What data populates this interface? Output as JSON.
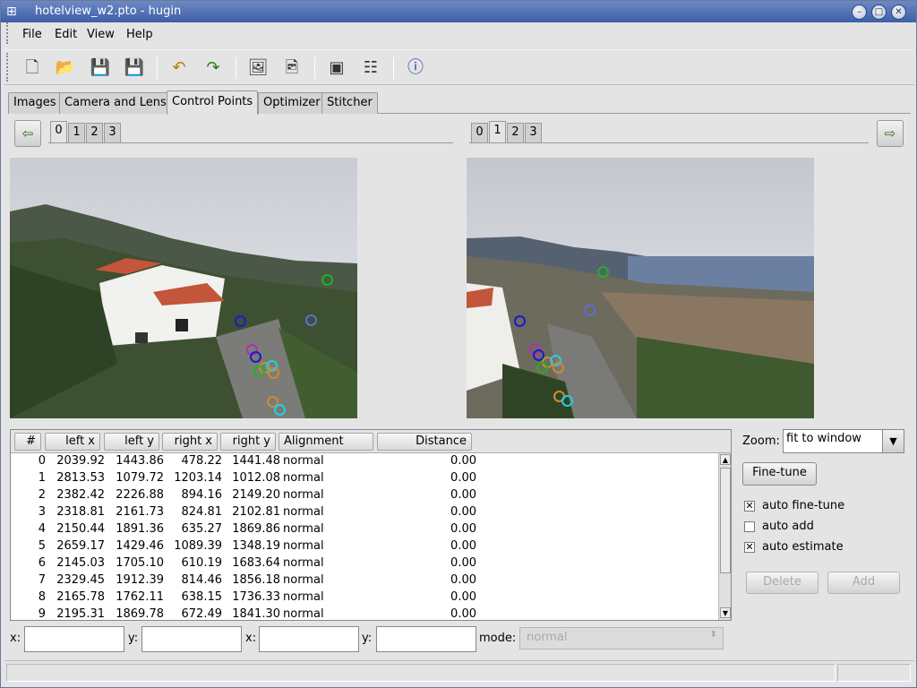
{
  "window": {
    "title": "hotelview_w2.pto - hugin"
  },
  "menu": {
    "items": [
      "File",
      "Edit",
      "View",
      "Help"
    ]
  },
  "toolbar": {
    "icons": [
      "new-file-icon",
      "open-folder-icon",
      "save-icon",
      "save-as-icon",
      "undo-icon",
      "redo-icon",
      "add-image-icon",
      "add-time-series-icon",
      "preview-icon",
      "assistant-icon",
      "info-icon"
    ]
  },
  "tabs": [
    "Images",
    "Camera and Lens",
    "Control Points",
    "Optimizer",
    "Stitcher"
  ],
  "left_images": {
    "tabs": [
      "0",
      "1",
      "2",
      "3"
    ],
    "selected": "0"
  },
  "right_images": {
    "tabs": [
      "0",
      "1",
      "2",
      "3"
    ],
    "selected": "1"
  },
  "table": {
    "headers": [
      "#",
      "left x",
      "left y",
      "right x",
      "right y",
      "Alignment",
      "Distance"
    ],
    "rows": [
      [
        "0",
        "2039.92",
        "1443.86",
        "478.22",
        "1441.48",
        "normal",
        "0.00"
      ],
      [
        "1",
        "2813.53",
        "1079.72",
        "1203.14",
        "1012.08",
        "normal",
        "0.00"
      ],
      [
        "2",
        "2382.42",
        "2226.88",
        "894.16",
        "2149.20",
        "normal",
        "0.00"
      ],
      [
        "3",
        "2318.81",
        "2161.73",
        "824.81",
        "2102.81",
        "normal",
        "0.00"
      ],
      [
        "4",
        "2150.44",
        "1891.36",
        "635.27",
        "1869.86",
        "normal",
        "0.00"
      ],
      [
        "5",
        "2659.17",
        "1429.46",
        "1089.39",
        "1348.19",
        "normal",
        "0.00"
      ],
      [
        "6",
        "2145.03",
        "1705.10",
        "610.19",
        "1683.64",
        "normal",
        "0.00"
      ],
      [
        "7",
        "2329.45",
        "1912.39",
        "814.46",
        "1856.18",
        "normal",
        "0.00"
      ],
      [
        "8",
        "2165.78",
        "1762.11",
        "638.15",
        "1736.33",
        "normal",
        "0.00"
      ],
      [
        "9",
        "2195.31",
        "1869.78",
        "672.49",
        "1841.30",
        "normal",
        "0.00"
      ]
    ]
  },
  "panel": {
    "zoom_label": "Zoom:",
    "zoom_value": "fit to window",
    "finetune_label": "Fine-tune",
    "auto_finetune": {
      "label": "auto fine-tune",
      "checked": true
    },
    "auto_add": {
      "label": "auto add",
      "checked": false
    },
    "auto_estimate": {
      "label": "auto estimate",
      "checked": true
    },
    "delete_label": "Delete",
    "add_label": "Add"
  },
  "edit": {
    "x1_label": "x:",
    "y1_label": "y:",
    "x2_label": "x:",
    "y2_label": "y:",
    "mode_label": "mode:",
    "mode_value": "normal"
  },
  "colors": {
    "accent": "#3d5ea8",
    "cp_green": "#1fb31f",
    "cp_blue": "#1a1acc",
    "cp_cyan": "#20d0e0",
    "cp_orange": "#d08a30",
    "cp_purple": "#b030b0"
  }
}
